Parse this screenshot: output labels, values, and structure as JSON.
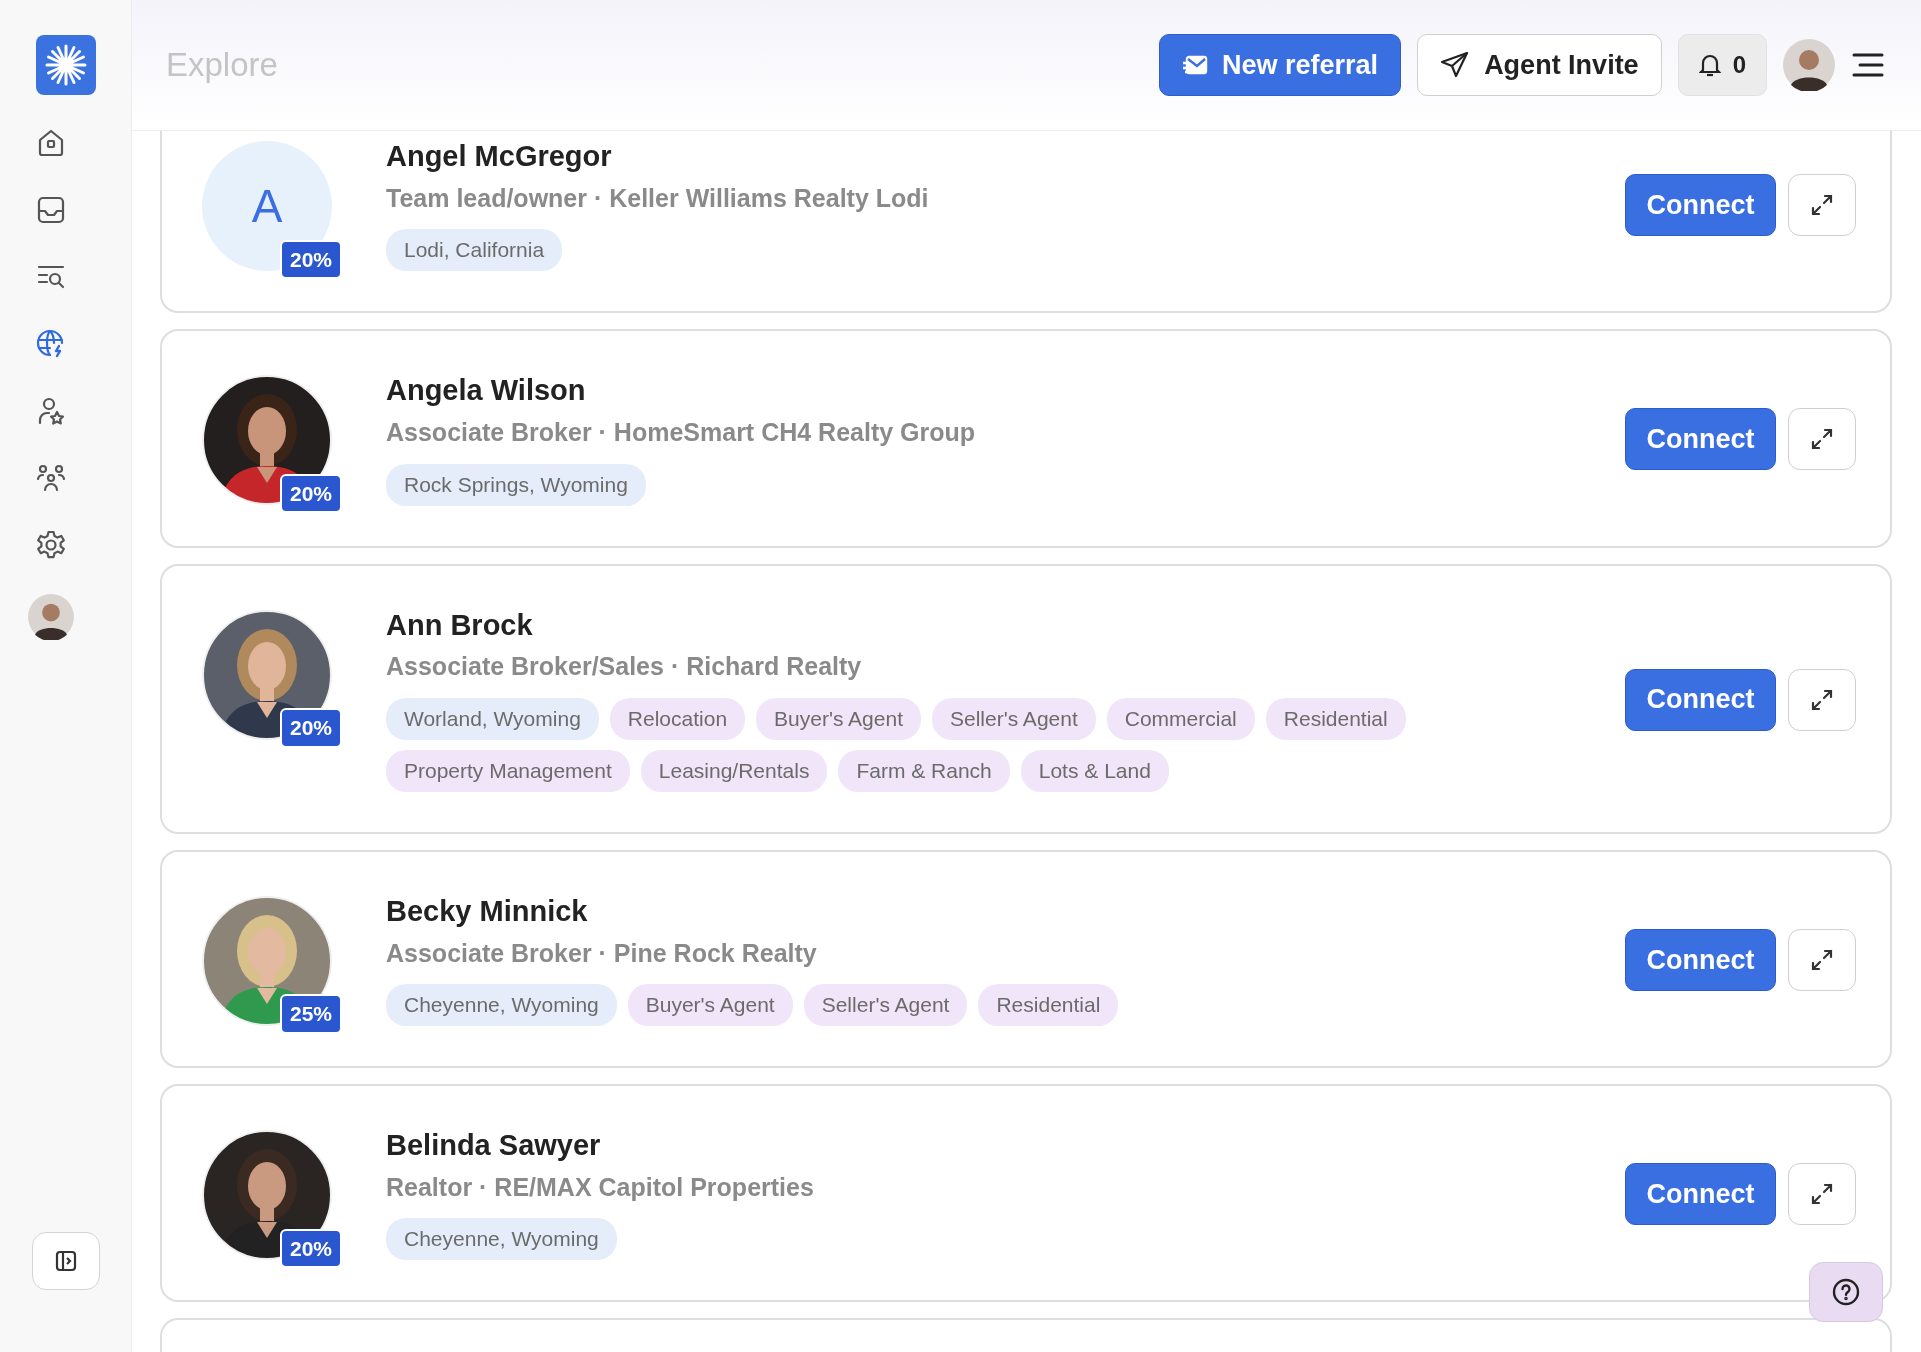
{
  "header": {
    "title": "Explore",
    "new_referral": "New referral",
    "agent_invite": "Agent Invite",
    "notifications": "0"
  },
  "sidebar": {
    "items": [
      {
        "kind": "home",
        "selected": false
      },
      {
        "kind": "inbox",
        "selected": false
      },
      {
        "kind": "search-list",
        "selected": false
      },
      {
        "kind": "globe",
        "selected": true
      },
      {
        "kind": "user-star",
        "selected": false
      },
      {
        "kind": "team",
        "selected": false
      },
      {
        "kind": "settings",
        "selected": false
      }
    ]
  },
  "agents": [
    {
      "name": "Angel McGregor",
      "subtitle": "Team lead/owner · Keller Williams Realty Lodi",
      "avatar": {
        "kind": "letter",
        "letter": "A"
      },
      "percent": "20%",
      "connect": "Connect",
      "tags": [
        {
          "label": "Lodi, California",
          "kind": "location"
        }
      ]
    },
    {
      "name": "Angela Wilson",
      "subtitle": "Associate Broker · HomeSmart CH4 Realty Group",
      "avatar": {
        "kind": "picture"
      },
      "percent": "20%",
      "connect": "Connect",
      "tags": [
        {
          "label": "Rock Springs, Wyoming",
          "kind": "location"
        }
      ]
    },
    {
      "name": "Ann Brock",
      "subtitle": "Associate Broker/Sales · Richard Realty",
      "avatar": {
        "kind": "picture"
      },
      "percent": "20%",
      "connect": "Connect",
      "tags": [
        {
          "label": "Worland, Wyoming",
          "kind": "location"
        },
        {
          "label": "Relocation",
          "kind": "specialty"
        },
        {
          "label": "Buyer's Agent",
          "kind": "specialty"
        },
        {
          "label": "Seller's Agent",
          "kind": "specialty"
        },
        {
          "label": "Commercial",
          "kind": "specialty"
        },
        {
          "label": "Residential",
          "kind": "specialty"
        },
        {
          "label": "Property Management",
          "kind": "specialty"
        },
        {
          "label": "Leasing/Rentals",
          "kind": "specialty"
        },
        {
          "label": "Farm & Ranch",
          "kind": "specialty"
        },
        {
          "label": "Lots & Land",
          "kind": "specialty"
        }
      ]
    },
    {
      "name": "Becky Minnick",
      "subtitle": "Associate Broker · Pine Rock Realty",
      "avatar": {
        "kind": "picture"
      },
      "percent": "25%",
      "connect": "Connect",
      "tags": [
        {
          "label": "Cheyenne, Wyoming",
          "kind": "location"
        },
        {
          "label": "Buyer's Agent",
          "kind": "specialty"
        },
        {
          "label": "Seller's Agent",
          "kind": "specialty"
        },
        {
          "label": "Residential",
          "kind": "specialty"
        }
      ]
    },
    {
      "name": "Belinda Sawyer",
      "subtitle": "Realtor · RE/MAX Capitol Properties",
      "avatar": {
        "kind": "picture"
      },
      "percent": "20%",
      "connect": "Connect",
      "tags": [
        {
          "label": "Cheyenne, Wyoming",
          "kind": "location"
        }
      ]
    }
  ]
}
